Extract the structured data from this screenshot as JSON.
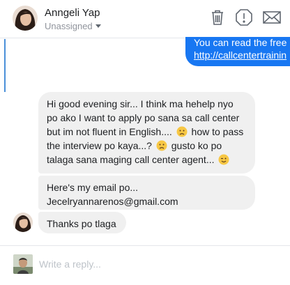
{
  "header": {
    "contact_name": "Anngeli Yap",
    "assignee": "Unassigned"
  },
  "icons": {
    "delete": "trash-icon",
    "spam": "alert-icon",
    "mark_unread": "envelope-icon"
  },
  "sent_message": {
    "line1": "You can read the free",
    "link": "http://callcentertrainin"
  },
  "messages": [
    {
      "parts": [
        "Hi good evening sir... I think ma hehelp nyo po ako I want to apply po sana sa call center but im not fluent in English....",
        "how to pass the interview po kaya...?",
        "gusto ko po talaga sana maging call center  agent...",
        ""
      ]
    },
    {
      "text_line1": "Here's my email po...",
      "text_line2": "Jecelryannarenos@gmail.com"
    },
    {
      "text": "Thanks po tlaga"
    }
  ],
  "composer": {
    "placeholder": "Write a reply..."
  },
  "colors": {
    "brand_blue": "#1877f2",
    "bubble_gray": "#f0f0f0",
    "thread_bar": "#4a90d9"
  }
}
